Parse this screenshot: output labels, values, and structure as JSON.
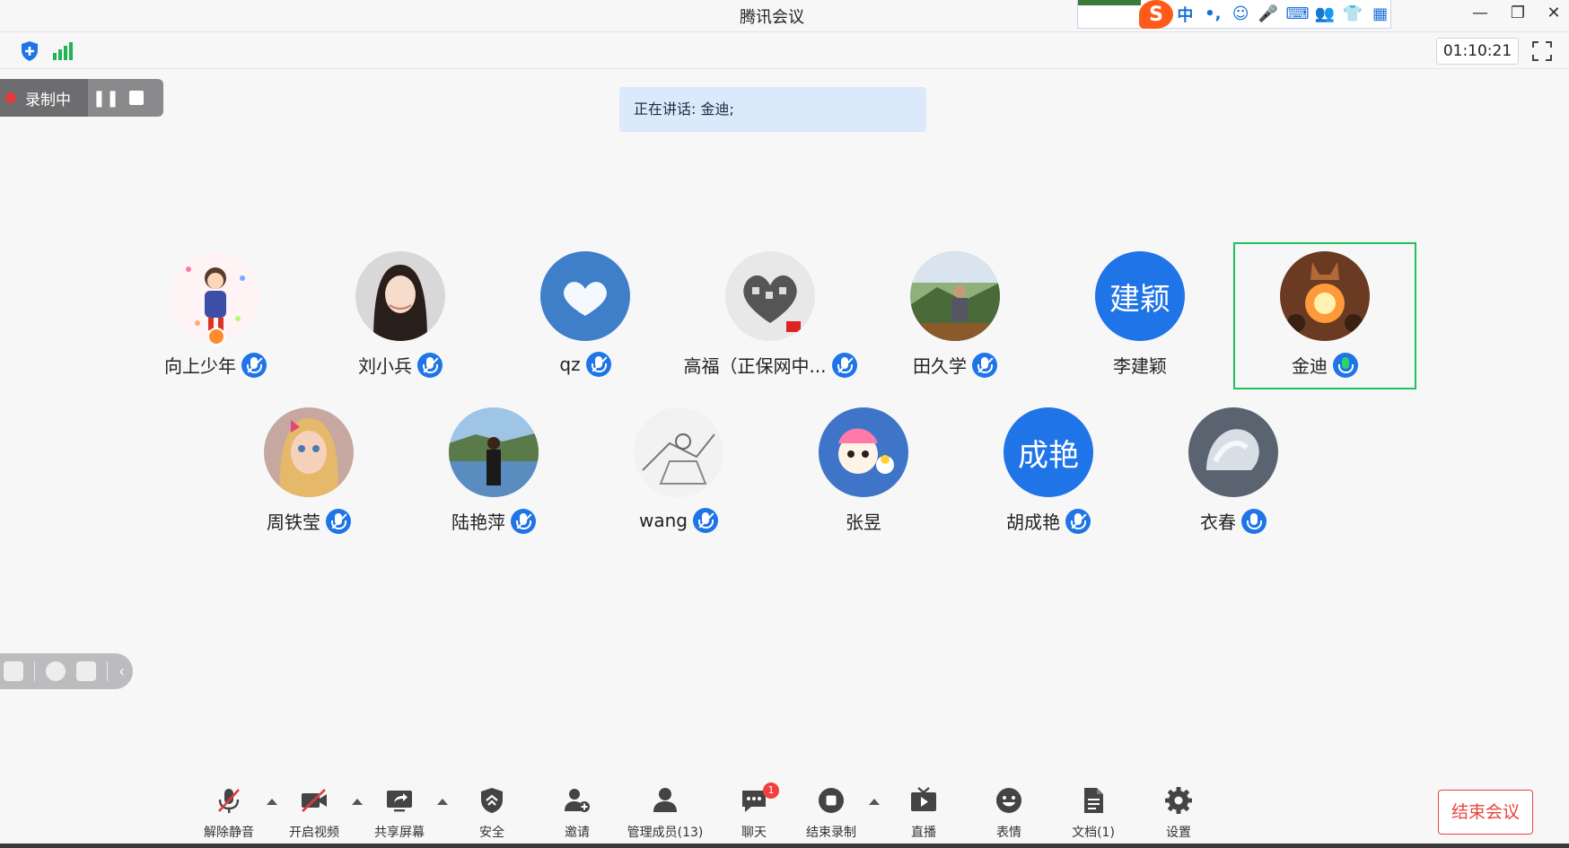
{
  "window": {
    "title": "腾讯会议"
  },
  "ime": {
    "logo": "S",
    "items": [
      "中",
      "•,",
      "☺",
      "🎤",
      "⌨",
      "👥",
      "👕",
      "▦"
    ]
  },
  "infobar": {
    "timer": "01:10:21"
  },
  "recording": {
    "label": "录制中"
  },
  "speaking": {
    "text": "正在讲话: 金迪;"
  },
  "participants": [
    {
      "name": "向上少年"
    },
    {
      "name": "刘小兵"
    },
    {
      "name": "qz"
    },
    {
      "name": "高福（正保网中..."
    },
    {
      "name": "田久学"
    },
    {
      "name": "李建颖",
      "avatar_text": "建颖"
    },
    {
      "name": "金迪"
    },
    {
      "name": "周铁莹"
    },
    {
      "name": "陆艳萍"
    },
    {
      "name": "wang"
    },
    {
      "name": "张昱"
    },
    {
      "name": "胡成艳",
      "avatar_text": "成艳"
    },
    {
      "name": "衣春"
    }
  ],
  "toolbar": {
    "unmute": "解除静音",
    "start_video": "开启视频",
    "share_screen": "共享屏幕",
    "security": "安全",
    "invite": "邀请",
    "manage_members": "管理成员(13)",
    "chat": "聊天",
    "chat_badge": "1",
    "end_recording": "结束录制",
    "live": "直播",
    "emoji": "表情",
    "docs": "文档(1)",
    "settings": "设置",
    "end_meeting": "结束会议"
  },
  "colors": {
    "accent": "#1f74e8",
    "active_speaker": "#20c05c",
    "danger": "#e5453f"
  }
}
